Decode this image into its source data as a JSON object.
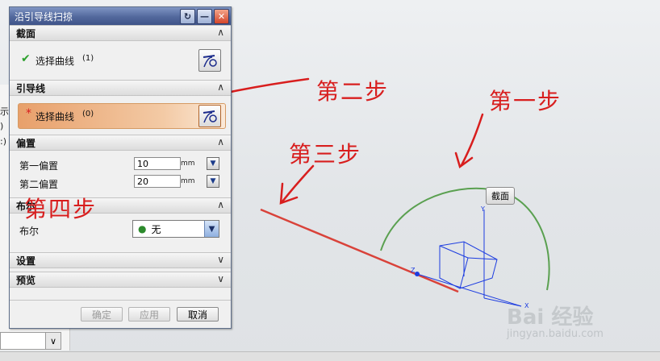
{
  "dialog": {
    "title": "沿引导线扫掠",
    "section_profile": {
      "title": "截面",
      "select_label": "选择曲线",
      "count": "(1)"
    },
    "section_guide": {
      "title": "引导线",
      "required_mark": "*",
      "select_label": "选择曲线",
      "count": "(0)"
    },
    "section_offset": {
      "title": "偏置",
      "first_label": "第一偏置",
      "first_value": "10",
      "first_unit": "mm",
      "second_label": "第二偏置",
      "second_value": "20",
      "second_unit": "mm"
    },
    "section_boolean": {
      "title": "布尔",
      "label": "布尔",
      "value": "无"
    },
    "section_settings": {
      "title": "设置"
    },
    "section_preview": {
      "title": "预览"
    },
    "buttons": {
      "ok": "确定",
      "apply": "应用",
      "cancel": "取消"
    }
  },
  "viewport": {
    "section_label": "截面",
    "axis_y": "Y",
    "axis_z": "Z",
    "axis_x": "X"
  },
  "annotations": {
    "step1": "第一步",
    "step2": "第二步",
    "step3": "第三步",
    "step4": "第四步"
  },
  "background_window": {
    "frag1": "示",
    "frag2": ")",
    "frag3": ":)",
    "combo_arrow": "∨"
  },
  "watermark": {
    "brand": "Bai 经验",
    "url": "jingyan.baidu.com"
  },
  "colors": {
    "annotation_red": "#d81e1e",
    "guide_highlight": "#e8a06b",
    "arc_green": "#5aa050",
    "line_red": "#d9423a",
    "axis_blue": "#1c3ce0",
    "check_green": "#2ca02c"
  },
  "icons": {
    "check": "check-icon",
    "curve_select": "curve-select-icon",
    "boolean": "boolean-none-icon"
  }
}
